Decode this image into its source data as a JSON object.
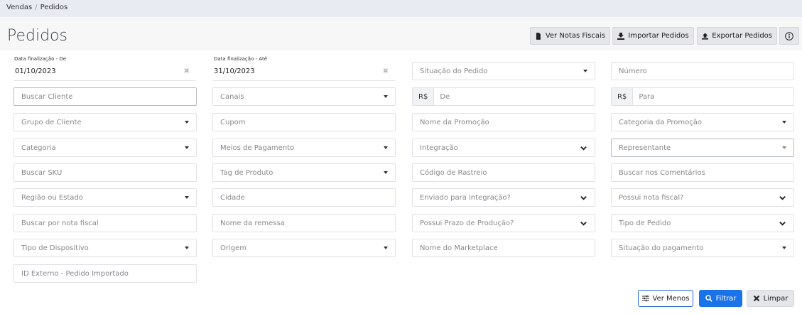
{
  "breadcrumb": {
    "parent": "Vendas",
    "current": "Pedidos"
  },
  "page": {
    "title": "Pedidos"
  },
  "header_buttons": {
    "notas": "Ver Notas Fiscais",
    "importar": "Importar Pedidos",
    "exportar": "Exportar Pedidos"
  },
  "filters": {
    "data_de_label": "Data finalização - De",
    "data_de_value": "01/10/2023",
    "data_ate_label": "Data finalização - Até",
    "data_ate_value": "31/10/2023",
    "situacao_pedido": "Situação do Pedido",
    "numero": "Número",
    "buscar_cliente": "Buscar Cliente",
    "canais": "Canais",
    "currency": "R$",
    "valor_de": "De",
    "valor_para": "Para",
    "grupo_cliente": "Grupo de Cliente",
    "cupom": "Cupom",
    "nome_promocao": "Nome da Promoção",
    "categoria_promocao": "Categoria da Promoção",
    "categoria": "Categoria",
    "meios_pagamento": "Meios de Pagamento",
    "integracao": "Integração",
    "representante": "Representante",
    "buscar_sku": "Buscar SKU",
    "tag_produto": "Tag de Produto",
    "codigo_rastreio": "Código de Rastreio",
    "buscar_comentarios": "Buscar nos Comentários",
    "regiao_estado": "Região ou Estado",
    "cidade": "Cidade",
    "enviado_integracao": "Enviado para integração?",
    "possui_nota": "Possui nota fiscal?",
    "buscar_nota": "Buscar por nota fiscal",
    "nome_remessa": "Nome da remessa",
    "prazo_producao": "Possui Prazo de Produção?",
    "tipo_pedido": "Tipo de Pedido",
    "tipo_dispositivo": "Tipo de Dispositivo",
    "origem": "Origem",
    "nome_marketplace": "Nome do Marketplace",
    "situacao_pagamento": "Situação do pagamento",
    "id_externo": "ID Externo - Pedido Importado"
  },
  "actions": {
    "ver_menos": "Ver Menos",
    "filtrar": "Filtrar",
    "limpar": "Limpar"
  },
  "colors": {
    "primary": "#1a73e8",
    "breadcrumb_bg": "#e8ebf2",
    "header_bg": "#f7f7f8"
  }
}
